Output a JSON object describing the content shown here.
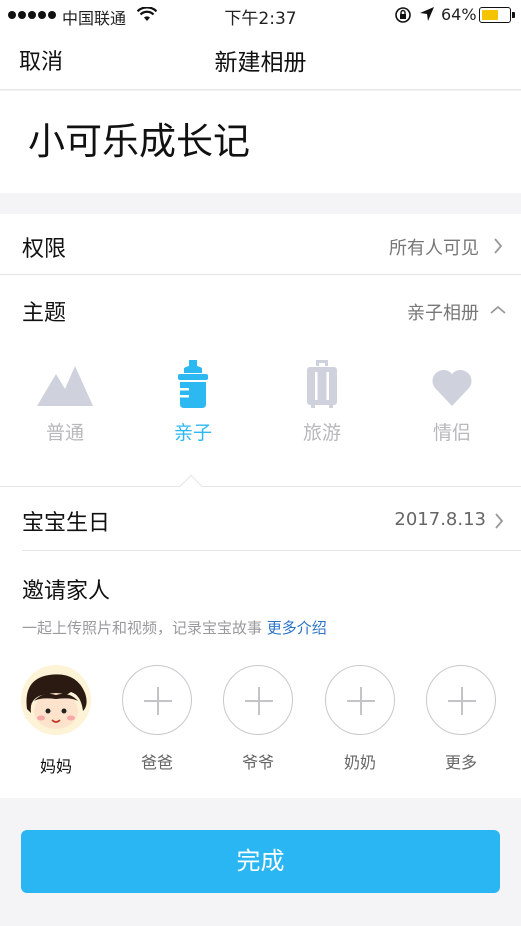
{
  "status_bar": {
    "carrier": "中国联通",
    "time": "下午2:37",
    "battery": "64%",
    "battery_level": 0.64,
    "battery_color": "#f5c400"
  },
  "nav": {
    "cancel": "取消",
    "title": "新建相册"
  },
  "album": {
    "name": "小可乐成长记"
  },
  "permission": {
    "label": "权限",
    "value": "所有人可见"
  },
  "theme": {
    "label": "主题",
    "value": "亲子相册",
    "options": [
      {
        "label": "普通",
        "icon": "mountain-icon"
      },
      {
        "label": "亲子",
        "icon": "baby-bottle-icon"
      },
      {
        "label": "旅游",
        "icon": "suitcase-icon"
      },
      {
        "label": "情侣",
        "icon": "heart-icon"
      }
    ],
    "selected_index": 1,
    "accent": "#2cb8f1"
  },
  "birthday": {
    "label": "宝宝生日",
    "value": "2017.8.13"
  },
  "invite": {
    "title": "邀请家人",
    "desc": "一起上传照片和视频，记录宝宝故事",
    "link": "更多介绍",
    "members": [
      {
        "name": "妈妈",
        "type": "avatar"
      },
      {
        "name": "爸爸",
        "type": "add"
      },
      {
        "name": "爷爷",
        "type": "add"
      },
      {
        "name": "奶奶",
        "type": "add"
      },
      {
        "name": "更多",
        "type": "add"
      }
    ]
  },
  "done": {
    "label": "完成",
    "color": "#29b6f2"
  }
}
